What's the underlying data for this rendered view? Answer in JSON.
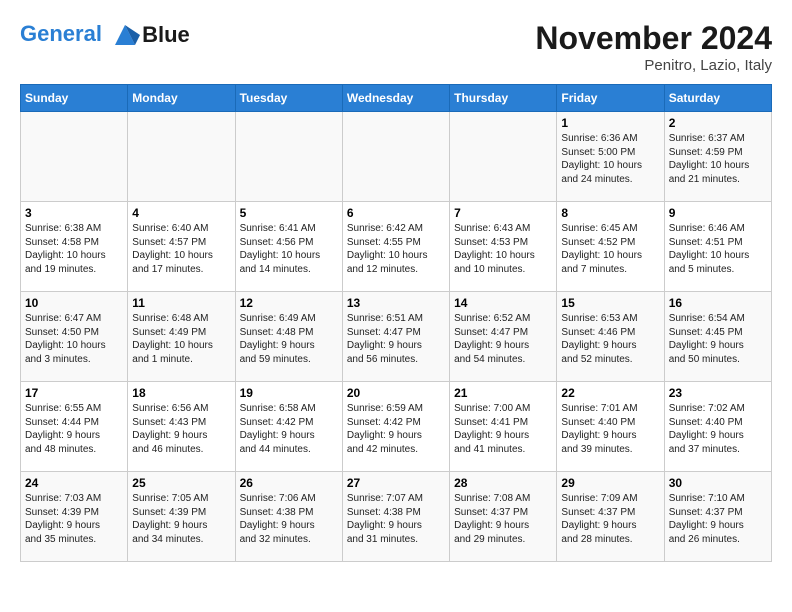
{
  "logo": {
    "line1": "General",
    "line2": "Blue"
  },
  "title": "November 2024",
  "location": "Penitro, Lazio, Italy",
  "headers": [
    "Sunday",
    "Monday",
    "Tuesday",
    "Wednesday",
    "Thursday",
    "Friday",
    "Saturday"
  ],
  "weeks": [
    [
      {
        "day": "",
        "info": ""
      },
      {
        "day": "",
        "info": ""
      },
      {
        "day": "",
        "info": ""
      },
      {
        "day": "",
        "info": ""
      },
      {
        "day": "",
        "info": ""
      },
      {
        "day": "1",
        "info": "Sunrise: 6:36 AM\nSunset: 5:00 PM\nDaylight: 10 hours\nand 24 minutes."
      },
      {
        "day": "2",
        "info": "Sunrise: 6:37 AM\nSunset: 4:59 PM\nDaylight: 10 hours\nand 21 minutes."
      }
    ],
    [
      {
        "day": "3",
        "info": "Sunrise: 6:38 AM\nSunset: 4:58 PM\nDaylight: 10 hours\nand 19 minutes."
      },
      {
        "day": "4",
        "info": "Sunrise: 6:40 AM\nSunset: 4:57 PM\nDaylight: 10 hours\nand 17 minutes."
      },
      {
        "day": "5",
        "info": "Sunrise: 6:41 AM\nSunset: 4:56 PM\nDaylight: 10 hours\nand 14 minutes."
      },
      {
        "day": "6",
        "info": "Sunrise: 6:42 AM\nSunset: 4:55 PM\nDaylight: 10 hours\nand 12 minutes."
      },
      {
        "day": "7",
        "info": "Sunrise: 6:43 AM\nSunset: 4:53 PM\nDaylight: 10 hours\nand 10 minutes."
      },
      {
        "day": "8",
        "info": "Sunrise: 6:45 AM\nSunset: 4:52 PM\nDaylight: 10 hours\nand 7 minutes."
      },
      {
        "day": "9",
        "info": "Sunrise: 6:46 AM\nSunset: 4:51 PM\nDaylight: 10 hours\nand 5 minutes."
      }
    ],
    [
      {
        "day": "10",
        "info": "Sunrise: 6:47 AM\nSunset: 4:50 PM\nDaylight: 10 hours\nand 3 minutes."
      },
      {
        "day": "11",
        "info": "Sunrise: 6:48 AM\nSunset: 4:49 PM\nDaylight: 10 hours\nand 1 minute."
      },
      {
        "day": "12",
        "info": "Sunrise: 6:49 AM\nSunset: 4:48 PM\nDaylight: 9 hours\nand 59 minutes."
      },
      {
        "day": "13",
        "info": "Sunrise: 6:51 AM\nSunset: 4:47 PM\nDaylight: 9 hours\nand 56 minutes."
      },
      {
        "day": "14",
        "info": "Sunrise: 6:52 AM\nSunset: 4:47 PM\nDaylight: 9 hours\nand 54 minutes."
      },
      {
        "day": "15",
        "info": "Sunrise: 6:53 AM\nSunset: 4:46 PM\nDaylight: 9 hours\nand 52 minutes."
      },
      {
        "day": "16",
        "info": "Sunrise: 6:54 AM\nSunset: 4:45 PM\nDaylight: 9 hours\nand 50 minutes."
      }
    ],
    [
      {
        "day": "17",
        "info": "Sunrise: 6:55 AM\nSunset: 4:44 PM\nDaylight: 9 hours\nand 48 minutes."
      },
      {
        "day": "18",
        "info": "Sunrise: 6:56 AM\nSunset: 4:43 PM\nDaylight: 9 hours\nand 46 minutes."
      },
      {
        "day": "19",
        "info": "Sunrise: 6:58 AM\nSunset: 4:42 PM\nDaylight: 9 hours\nand 44 minutes."
      },
      {
        "day": "20",
        "info": "Sunrise: 6:59 AM\nSunset: 4:42 PM\nDaylight: 9 hours\nand 42 minutes."
      },
      {
        "day": "21",
        "info": "Sunrise: 7:00 AM\nSunset: 4:41 PM\nDaylight: 9 hours\nand 41 minutes."
      },
      {
        "day": "22",
        "info": "Sunrise: 7:01 AM\nSunset: 4:40 PM\nDaylight: 9 hours\nand 39 minutes."
      },
      {
        "day": "23",
        "info": "Sunrise: 7:02 AM\nSunset: 4:40 PM\nDaylight: 9 hours\nand 37 minutes."
      }
    ],
    [
      {
        "day": "24",
        "info": "Sunrise: 7:03 AM\nSunset: 4:39 PM\nDaylight: 9 hours\nand 35 minutes."
      },
      {
        "day": "25",
        "info": "Sunrise: 7:05 AM\nSunset: 4:39 PM\nDaylight: 9 hours\nand 34 minutes."
      },
      {
        "day": "26",
        "info": "Sunrise: 7:06 AM\nSunset: 4:38 PM\nDaylight: 9 hours\nand 32 minutes."
      },
      {
        "day": "27",
        "info": "Sunrise: 7:07 AM\nSunset: 4:38 PM\nDaylight: 9 hours\nand 31 minutes."
      },
      {
        "day": "28",
        "info": "Sunrise: 7:08 AM\nSunset: 4:37 PM\nDaylight: 9 hours\nand 29 minutes."
      },
      {
        "day": "29",
        "info": "Sunrise: 7:09 AM\nSunset: 4:37 PM\nDaylight: 9 hours\nand 28 minutes."
      },
      {
        "day": "30",
        "info": "Sunrise: 7:10 AM\nSunset: 4:37 PM\nDaylight: 9 hours\nand 26 minutes."
      }
    ]
  ]
}
